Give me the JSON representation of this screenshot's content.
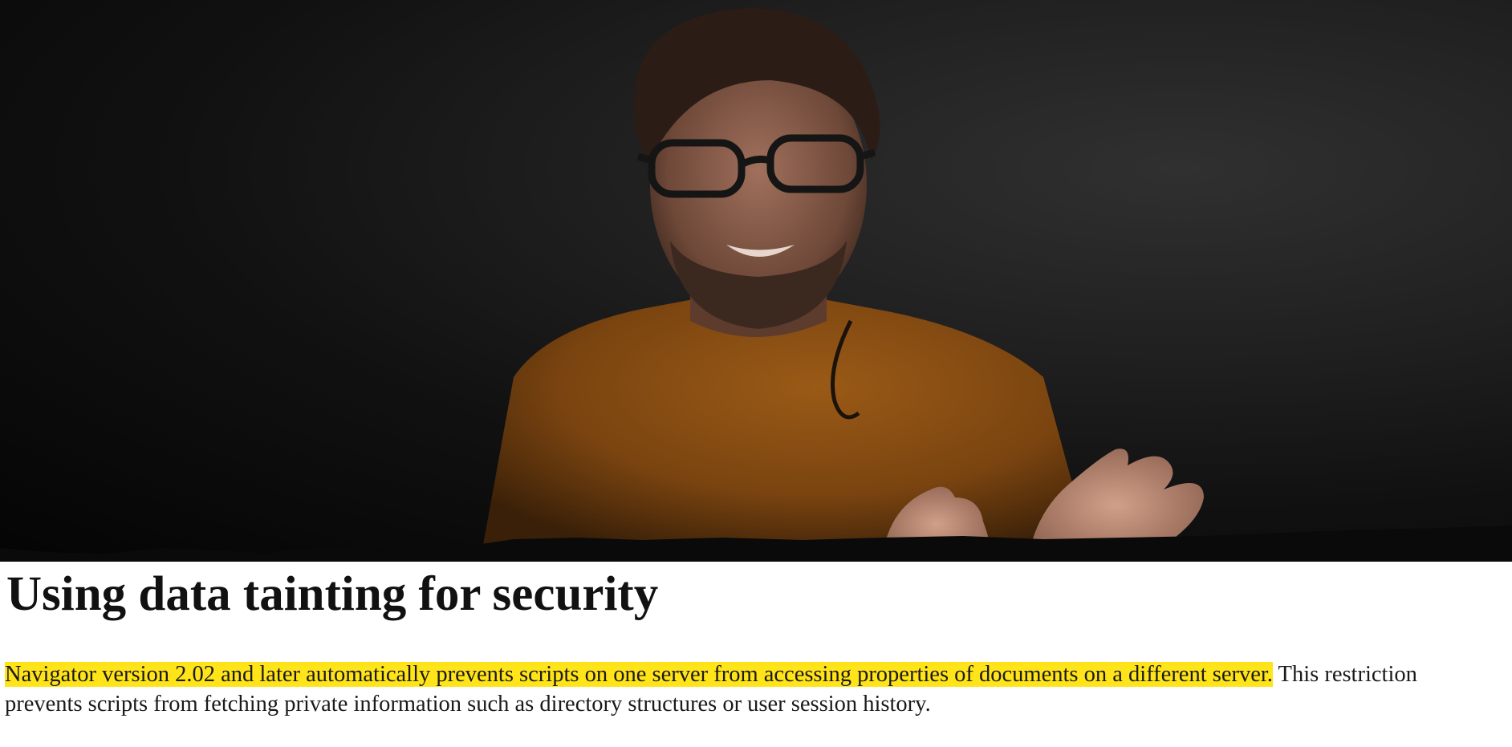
{
  "video": {
    "subject": "presenter-photo"
  },
  "article": {
    "title": "Using data tainting for security",
    "paragraph": {
      "highlighted": "Navigator version 2.02 and later automatically prevents scripts on one server from accessing properties of documents on a different server.",
      "rest": " This restriction prevents scripts from fetching private information such as directory structures or user session history."
    }
  },
  "colors": {
    "highlight": "#ffe419",
    "shirt": "#8a4f12",
    "background_dark": "#111111"
  }
}
